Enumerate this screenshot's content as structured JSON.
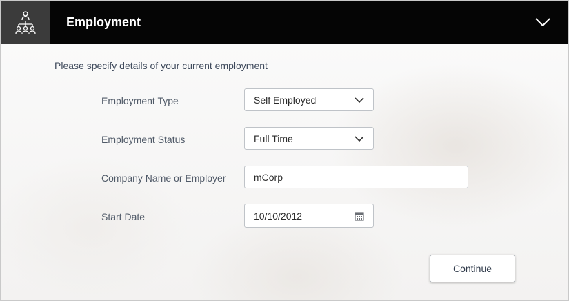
{
  "header": {
    "title": "Employment",
    "icon": "org-structure-icon",
    "collapse_icon": "chevron-down-icon"
  },
  "intro_text": "Please specify details of your current employment",
  "form": {
    "employment_type": {
      "label": "Employment Type",
      "value": "Self Employed",
      "icon": "chevron-down-icon"
    },
    "employment_status": {
      "label": "Employment Status",
      "value": "Full Time",
      "icon": "chevron-down-icon"
    },
    "company_name": {
      "label": "Company Name or Employer",
      "value": "mCorp"
    },
    "start_date": {
      "label": "Start Date",
      "value": "10/10/2012",
      "icon": "calendar-icon"
    }
  },
  "actions": {
    "continue_label": "Continue"
  },
  "colors": {
    "header_bg": "#050505",
    "header_icon_bg": "#3b3b3b",
    "text": "#505a68",
    "field_border": "#bfc3c8"
  }
}
